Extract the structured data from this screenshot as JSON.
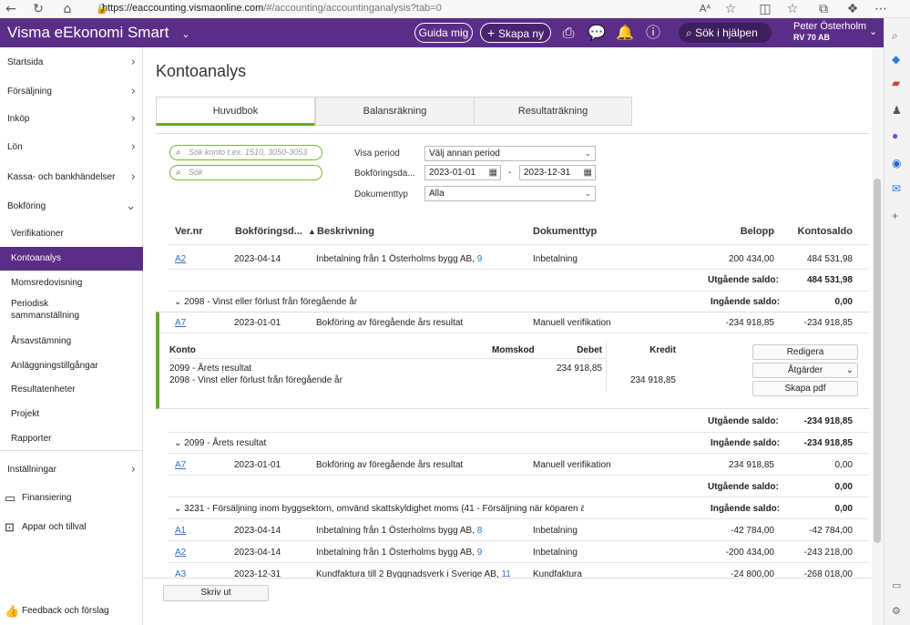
{
  "browser": {
    "url_host": "https://eaccounting.vismaonline.com",
    "url_path": "/#/accounting/accountinganalysis?tab=0"
  },
  "appbar": {
    "brand": "Visma eEkonomi Smart",
    "guide_label": "Guida mig",
    "create_label": "Skapa ny",
    "search_label": "Sök i hjälpen",
    "user_name": "Peter Österholm",
    "user_org": "RV 70 AB"
  },
  "sidebar": {
    "items": [
      {
        "label": "Startsida"
      },
      {
        "label": "Försäljning"
      },
      {
        "label": "Inköp"
      },
      {
        "label": "Lön"
      },
      {
        "label": "Kassa- och bankhändelser"
      },
      {
        "label": "Bokföring"
      },
      {
        "label": "Verifikationer"
      },
      {
        "label": "Kontoanalys"
      },
      {
        "label": "Momsredovisning"
      },
      {
        "label": "Periodisk"
      },
      {
        "label": "sammanställning"
      },
      {
        "label": "Årsavstämning"
      },
      {
        "label": "Anläggningstillgångar"
      },
      {
        "label": "Resultatenheter"
      },
      {
        "label": "Projekt"
      },
      {
        "label": "Rapporter"
      },
      {
        "label": "Inställningar"
      },
      {
        "label": "Finansiering"
      },
      {
        "label": "Appar och tillval"
      },
      {
        "label": "Feedback och förslag"
      }
    ]
  },
  "page": {
    "title": "Kontoanalys",
    "tabs": [
      {
        "label": "Huvudbok"
      },
      {
        "label": "Balansräkning"
      },
      {
        "label": "Resultaträkning"
      }
    ]
  },
  "filters": {
    "search_account_placeholder": "Sök konto t.ex. 1510, 3050-3053",
    "search_placeholder": "Sök",
    "visa_period_label": "Visa period",
    "visa_period_value": "Välj annan period",
    "bokforingsdatum_label": "Bokföringsda...",
    "date_from": "2023-01-01",
    "date_sep": "-",
    "date_to": "2023-12-31",
    "dokumenttyp_label": "Dokumenttyp",
    "dokumenttyp_value": "Alla"
  },
  "table": {
    "headers": {
      "vernr": "Ver.nr",
      "bokforingsdatum": "Bokföringsd...",
      "beskrivning": "Beskrivning",
      "dokumenttyp": "Dokumenttyp",
      "belopp": "Belopp",
      "kontosaldo": "Kontosaldo"
    },
    "r1": {
      "ver": "A2",
      "date": "2023-04-14",
      "desc": "Inbetalning från 1 Österholms bygg AB,",
      "desc_num": "9",
      "type": "Inbetalning",
      "amount": "200 434,00",
      "balance": "484 531,98"
    },
    "utg_label": "Utgående saldo:",
    "ing_label": "Ingående saldo:",
    "utg1": "484 531,98",
    "g2098": "2098 - Vinst eller förlust från föregående år",
    "ing2098": "0,00",
    "r2": {
      "ver": "A7",
      "date": "2023-01-01",
      "desc": "Bokföring av föregående års resultat",
      "type": "Manuell verifikation",
      "amount": "-234 918,85",
      "balance": "-234 918,85"
    },
    "detail": {
      "h_konto": "Konto",
      "h_momskod": "Momskod",
      "h_debet": "Debet",
      "h_kredit": "Kredit",
      "l1_konto": "2099 - Årets resultat",
      "l1_debet": "234 918,85",
      "l2_konto": "2098 - Vinst eller förlust från föregående år",
      "l2_kredit": "234 918,85",
      "btn_edit": "Redigera",
      "btn_actions": "Åtgärder",
      "btn_pdf": "Skapa pdf"
    },
    "utg2": "-234 918,85",
    "g2099": "2099 - Årets resultat",
    "ing2099": "-234 918,85",
    "r3": {
      "ver": "A7",
      "date": "2023-01-01",
      "desc": "Bokföring av föregående års resultat",
      "type": "Manuell verifikation",
      "amount": "234 918,85",
      "balance": "0,00"
    },
    "utg3": "0,00",
    "g3231": "3231 - Försäljning inom byggsektorn, omvänd skattskyldighet moms (41 - Försäljning när köparen är s",
    "ing3231": "0,00",
    "r4": {
      "ver": "A1",
      "date": "2023-04-14",
      "desc": "Inbetalning från 1 Österholms bygg AB,",
      "desc_num": "8",
      "type": "Inbetalning",
      "amount": "-42 784,00",
      "balance": "-42 784,00"
    },
    "r5": {
      "ver": "A2",
      "date": "2023-04-14",
      "desc": "Inbetalning från 1 Österholms bygg AB,",
      "desc_num": "9",
      "type": "Inbetalning",
      "amount": "-200 434,00",
      "balance": "-243 218,00"
    },
    "r6": {
      "ver": "A3",
      "date": "2023-12-31",
      "desc": "Kundfaktura till 2 Byggnadsverk i Sverige AB,",
      "desc_num": "11",
      "type": "Kundfaktura",
      "amount": "-24 800,00",
      "balance": "-268 018,00"
    }
  },
  "footer": {
    "print_label": "Skriv ut"
  }
}
